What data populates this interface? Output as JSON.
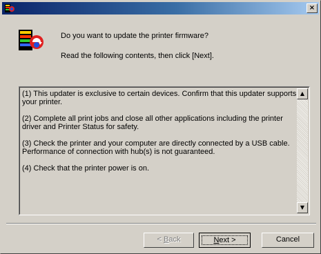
{
  "window": {
    "title": "",
    "close_glyph": "×"
  },
  "header": {
    "question": "Do you want to update the printer firmware?",
    "instruction": "Read the following contents, then click [Next]."
  },
  "notes": [
    "(1) This updater is exclusive to certain devices. Confirm that this updater supports your printer.",
    "(2) Complete all print jobs and close all other applications including the printer driver and Printer Status for safety.",
    "(3) Check the printer and your computer are directly connected by a USB cable. Performance of connection with hub(s) is not guaranteed.",
    "(4) Check that the printer power is on."
  ],
  "buttons": {
    "back": {
      "prefix": "< ",
      "mnemonic": "B",
      "rest": "ack",
      "enabled": false
    },
    "next": {
      "mnemonic": "N",
      "rest": "ext >",
      "enabled": true
    },
    "cancel": "Cancel"
  },
  "icons": {
    "app": "printer-update-icon",
    "header": "printer-update-icon",
    "scroll_up": "scroll-up-arrow-icon",
    "scroll_down": "scroll-down-arrow-icon",
    "close": "close-icon"
  },
  "colors": {
    "face": "#d4d0c8",
    "title_start": "#0a246a",
    "title_end": "#a6caf0"
  }
}
